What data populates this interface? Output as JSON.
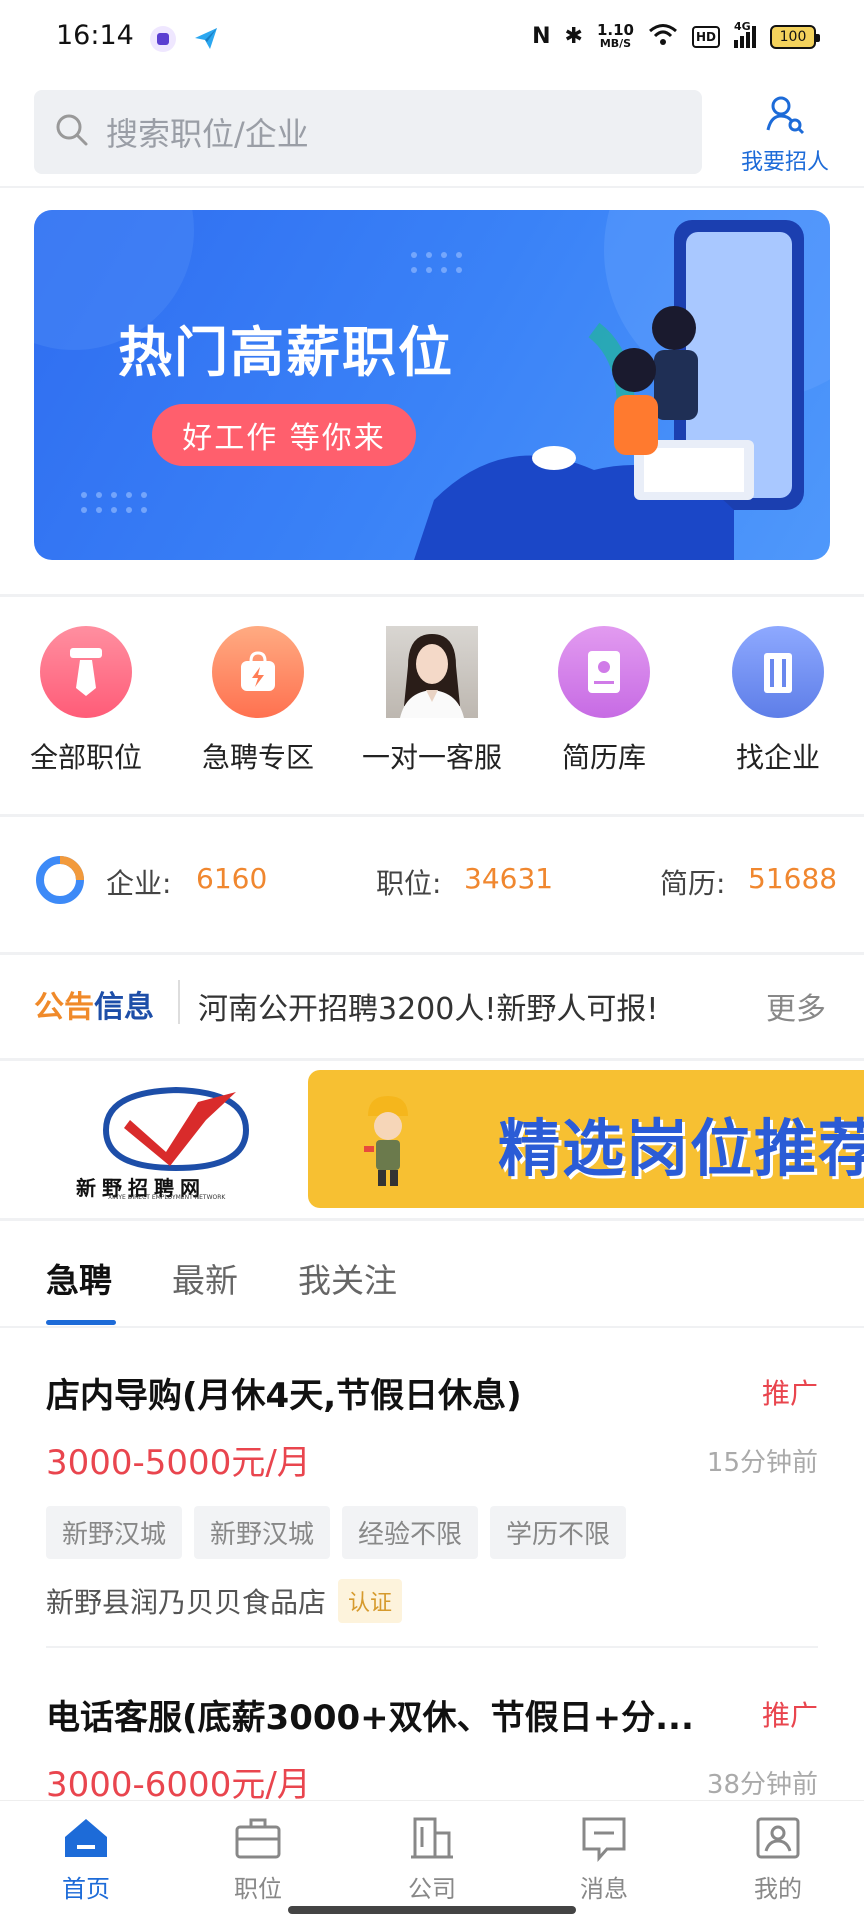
{
  "status_bar": {
    "time": "16:14",
    "speed_top": "1.10",
    "speed_unit": "MB/S",
    "hd": "HD",
    "network": "4G",
    "battery": "100"
  },
  "search": {
    "placeholder": "搜索职位/企业"
  },
  "recruit_button": {
    "label": "我要招人"
  },
  "banner": {
    "title": "热门高薪职位",
    "slogan": "好工作 等你来"
  },
  "quick_links": [
    {
      "label": "全部职位",
      "icon": "tie-icon",
      "color": "#ff6b81"
    },
    {
      "label": "急聘专区",
      "icon": "lightning-bag-icon",
      "color": "#ff8a5c"
    },
    {
      "label": "一对一客服",
      "icon": "customer-service-avatar",
      "color": "#888888"
    },
    {
      "label": "简历库",
      "icon": "resume-book-icon",
      "color": "#c879e8"
    },
    {
      "label": "找企业",
      "icon": "building-icon",
      "color": "#6c8df2"
    }
  ],
  "stats": {
    "company_label": "企业:",
    "company_value": "6160",
    "job_label": "职位:",
    "job_value": "34631",
    "resume_label": "简历:",
    "resume_value": "51688"
  },
  "notice": {
    "badge_a": "公告",
    "badge_b": "信息",
    "text": "河南公开招聘3200人!新野人可报!",
    "more": "更多"
  },
  "promo": {
    "logo_text": "新野招聘网",
    "logo_sub": "XINYE DIRECT EMPLOYMENT NETWORK",
    "banner_text": "精选岗位推荐"
  },
  "tabs": [
    "急聘",
    "最新",
    "我关注"
  ],
  "jobs": [
    {
      "title": "店内导购(月休4天,节假日休息)",
      "tag": "推广",
      "salary": "3000-5000元/月",
      "time": "15分钟前",
      "tags": [
        "新野汉城",
        "新野汉城",
        "经验不限",
        "学历不限"
      ],
      "company": "新野县润乃贝贝食品店",
      "cert": "认证"
    },
    {
      "title": "电话客服(底薪3000+双休、节假日+分...",
      "tag": "推广",
      "salary": "3000-6000元/月",
      "time": "38分钟前"
    }
  ],
  "bottom_nav": [
    {
      "label": "首页",
      "icon": "home-icon"
    },
    {
      "label": "职位",
      "icon": "briefcase-icon"
    },
    {
      "label": "公司",
      "icon": "company-building-icon"
    },
    {
      "label": "消息",
      "icon": "message-icon"
    },
    {
      "label": "我的",
      "icon": "profile-icon"
    }
  ],
  "colors": {
    "accent": "#1d6bd8",
    "salary": "#e9454e",
    "stat": "#f0872f"
  }
}
